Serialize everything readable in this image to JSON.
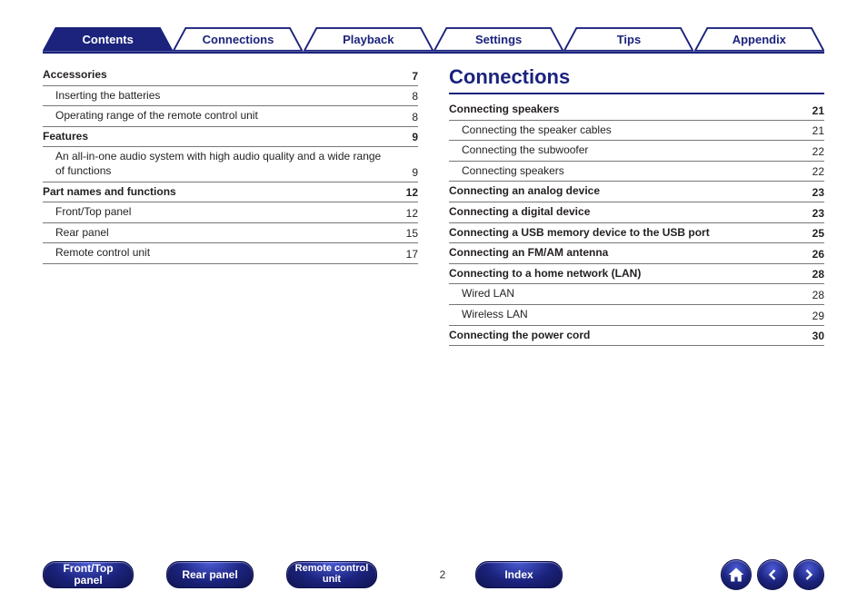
{
  "tabs": [
    {
      "label": "Contents",
      "active": true
    },
    {
      "label": "Connections",
      "active": false
    },
    {
      "label": "Playback",
      "active": false
    },
    {
      "label": "Settings",
      "active": false
    },
    {
      "label": "Tips",
      "active": false
    },
    {
      "label": "Appendix",
      "active": false
    }
  ],
  "left_toc": [
    {
      "label": "Accessories",
      "page": "7",
      "main": true
    },
    {
      "label": "Inserting the batteries",
      "page": "8",
      "main": false
    },
    {
      "label": "Operating range of the remote control unit",
      "page": "8",
      "main": false
    },
    {
      "label": "Features",
      "page": "9",
      "main": true
    },
    {
      "label": "An all-in-one audio system with high audio quality and a wide range of functions",
      "page": "9",
      "main": false
    },
    {
      "label": "Part names and functions",
      "page": "12",
      "main": true
    },
    {
      "label": "Front/Top panel",
      "page": "12",
      "main": false
    },
    {
      "label": "Rear panel",
      "page": "15",
      "main": false
    },
    {
      "label": "Remote control unit",
      "page": "17",
      "main": false
    }
  ],
  "right_title": "Connections",
  "right_toc": [
    {
      "label": "Connecting speakers",
      "page": "21",
      "main": true
    },
    {
      "label": "Connecting the speaker cables",
      "page": "21",
      "main": false
    },
    {
      "label": "Connecting the subwoofer",
      "page": "22",
      "main": false
    },
    {
      "label": "Connecting speakers",
      "page": "22",
      "main": false
    },
    {
      "label": "Connecting an analog device",
      "page": "23",
      "main": true
    },
    {
      "label": "Connecting a digital device",
      "page": "23",
      "main": true
    },
    {
      "label": "Connecting a USB memory device to the USB port",
      "page": "25",
      "main": true
    },
    {
      "label": "Connecting an FM/AM antenna",
      "page": "26",
      "main": true
    },
    {
      "label": "Connecting to a home network (LAN)",
      "page": "28",
      "main": true
    },
    {
      "label": "Wired LAN",
      "page": "28",
      "main": false
    },
    {
      "label": "Wireless LAN",
      "page": "29",
      "main": false
    },
    {
      "label": "Connecting the power cord",
      "page": "30",
      "main": true
    }
  ],
  "footer": {
    "front_top": "Front/Top\npanel",
    "rear": "Rear panel",
    "remote": "Remote control\nunit",
    "index": "Index",
    "page_number": "2"
  }
}
